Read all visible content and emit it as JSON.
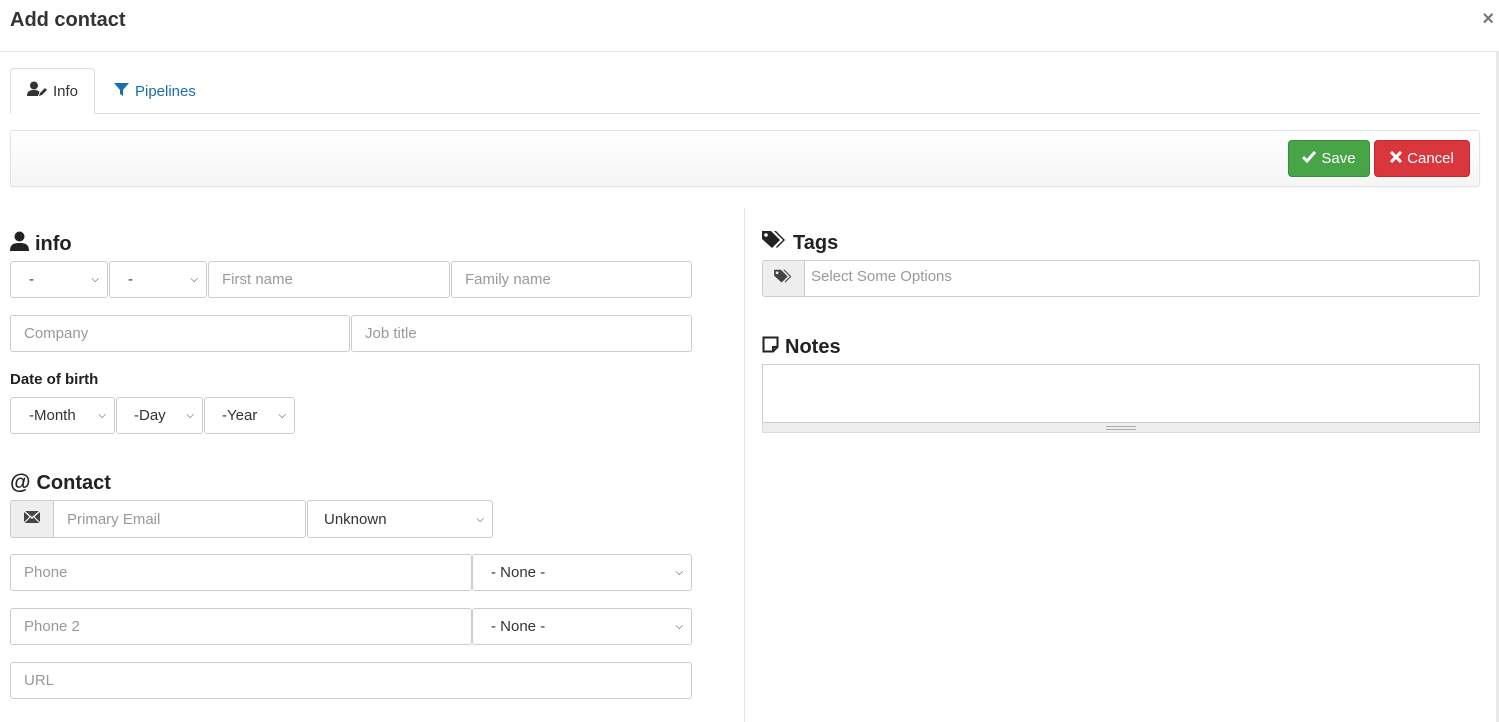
{
  "modal": {
    "title": "Add contact",
    "close_label": "×"
  },
  "tabs": [
    {
      "label": "Info",
      "icon": "user-edit-icon",
      "active": true
    },
    {
      "label": "Pipelines",
      "icon": "filter-icon",
      "active": false
    }
  ],
  "toolbar": {
    "save_label": "Save",
    "cancel_label": "Cancel"
  },
  "info_section": {
    "title": "info",
    "salutation_select": "-",
    "title_select": "-",
    "first_name_placeholder": "First name",
    "family_name_placeholder": "Family name",
    "company_placeholder": "Company",
    "job_title_placeholder": "Job title",
    "dob_label": "Date of birth",
    "dob_month": "-Month",
    "dob_day": "-Day",
    "dob_year": "-Year"
  },
  "contact_section": {
    "title": "Contact",
    "email_placeholder": "Primary Email",
    "email_type": "Unknown",
    "phone_placeholder": "Phone",
    "phone_type": "- None -",
    "phone2_placeholder": "Phone 2",
    "phone2_type": "- None -",
    "url_placeholder": "URL"
  },
  "tags_section": {
    "title": "Tags",
    "placeholder": "Select Some Options"
  },
  "notes_section": {
    "title": "Notes"
  },
  "colors": {
    "save": "#47a447",
    "cancel": "#d9363e",
    "link": "#1a6fb0"
  }
}
